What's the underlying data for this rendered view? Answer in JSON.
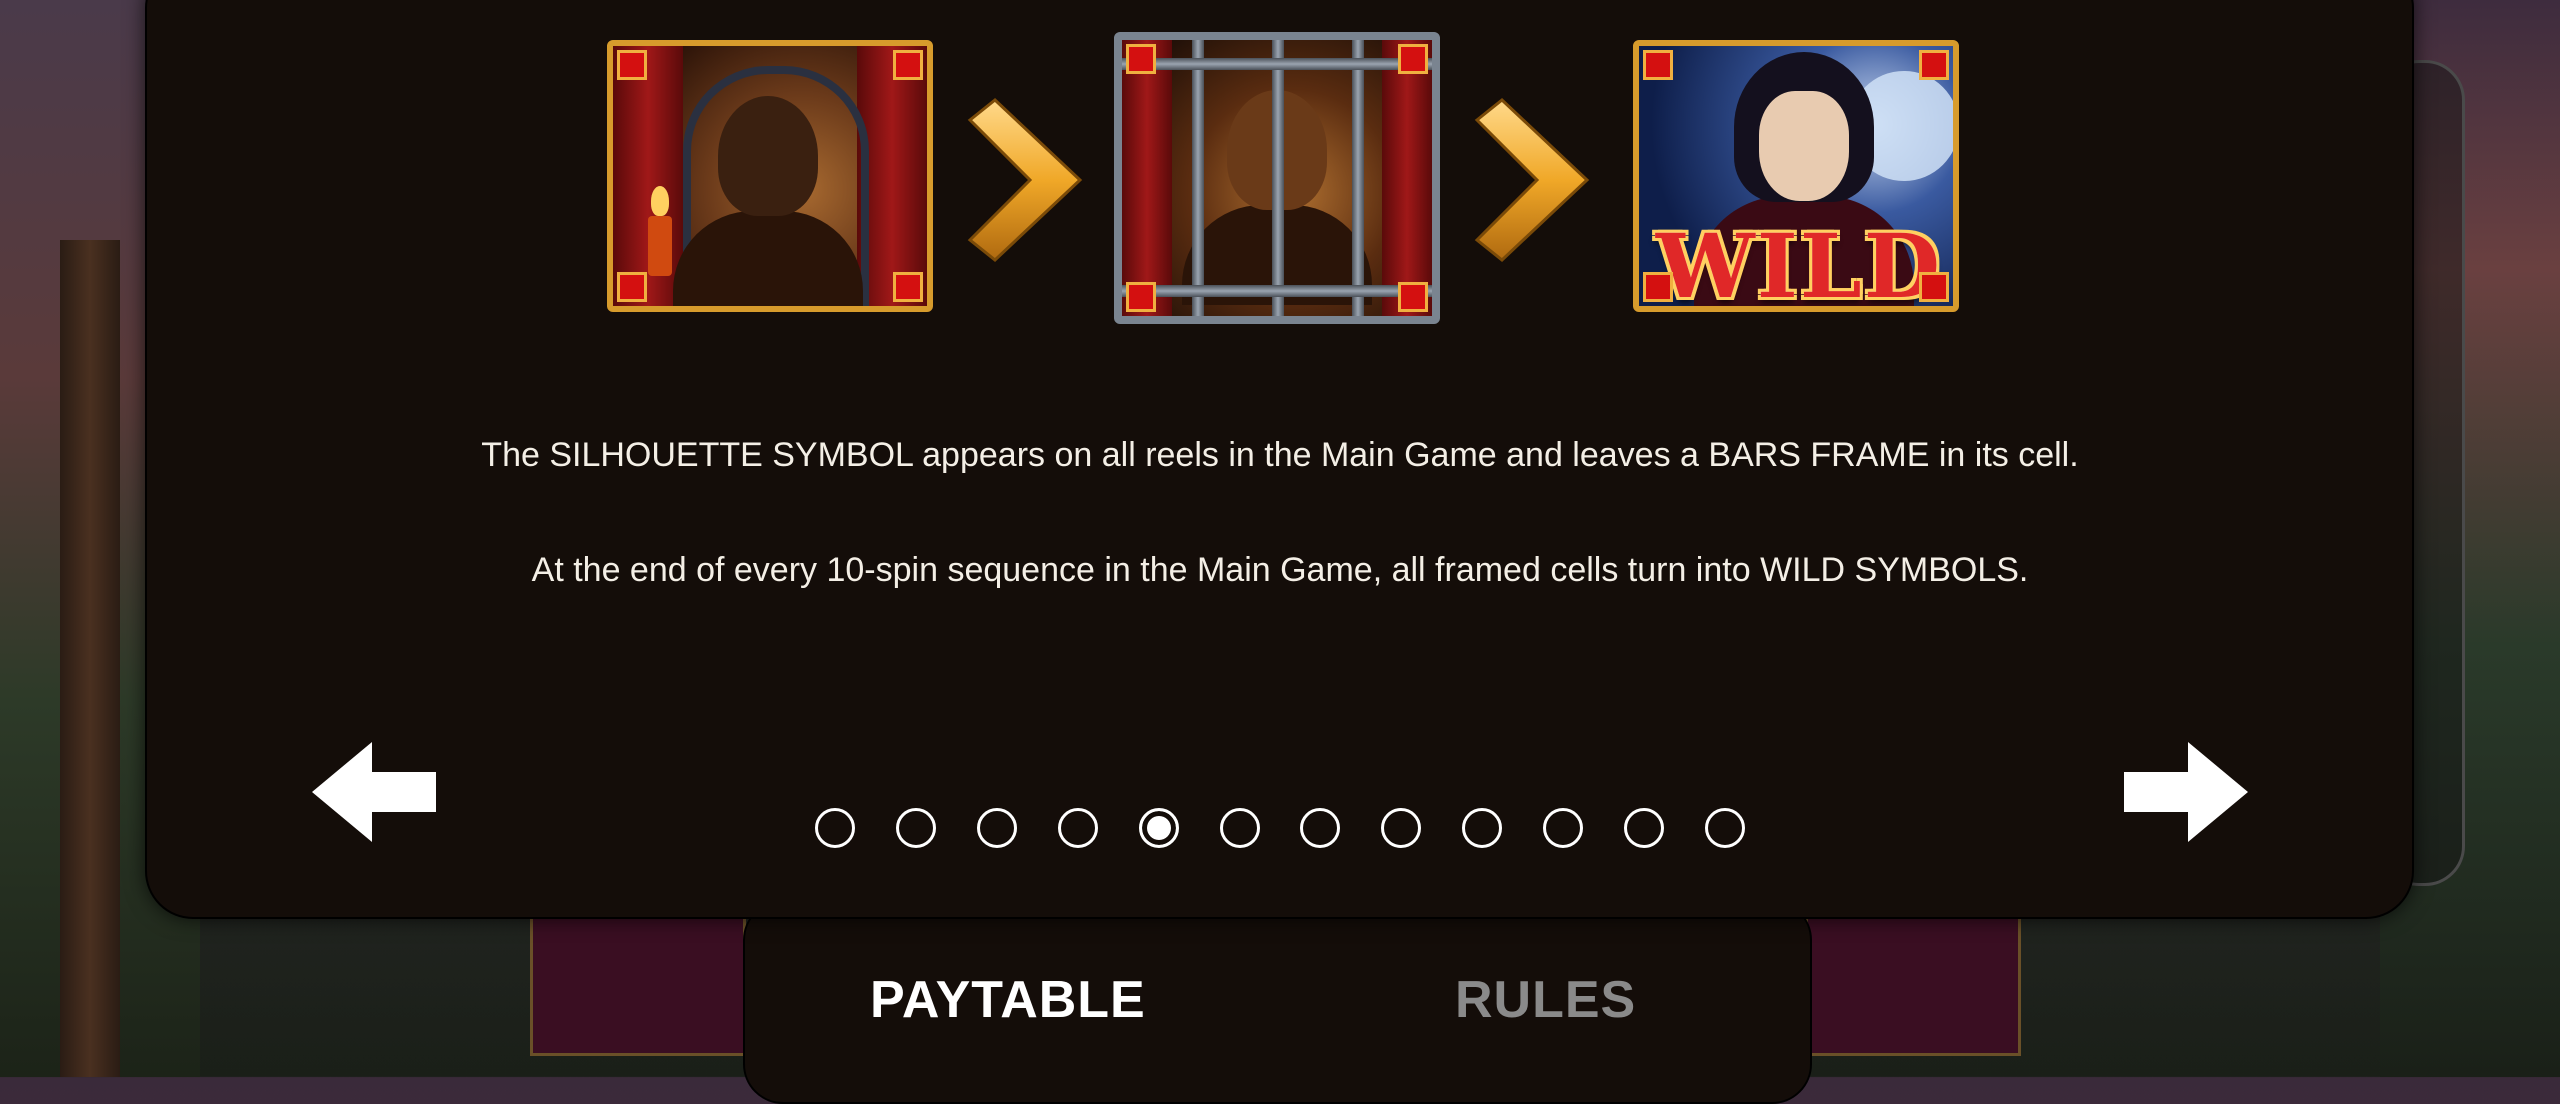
{
  "symbols": [
    {
      "name": "silhouette-symbol"
    },
    {
      "name": "bars-frame-symbol"
    },
    {
      "name": "wild-symbol",
      "label": "WILD"
    }
  ],
  "description": [
    "The SILHOUETTE SYMBOL appears on all reels in the Main Game and leaves a BARS FRAME in its cell.",
    "At the end of every 10-spin sequence in the Main Game, all framed cells turn into WILD SYMBOLS."
  ],
  "pagination": {
    "total_pages": 12,
    "current_page": 5
  },
  "tabs": {
    "paytable": "PAYTABLE",
    "rules": "RULES",
    "active": "paytable"
  },
  "colors": {
    "panel_bg": "#140d09",
    "gold": "#d79b2c",
    "text": "#f4efe6",
    "inactive_tab": "#8a8a8a"
  }
}
